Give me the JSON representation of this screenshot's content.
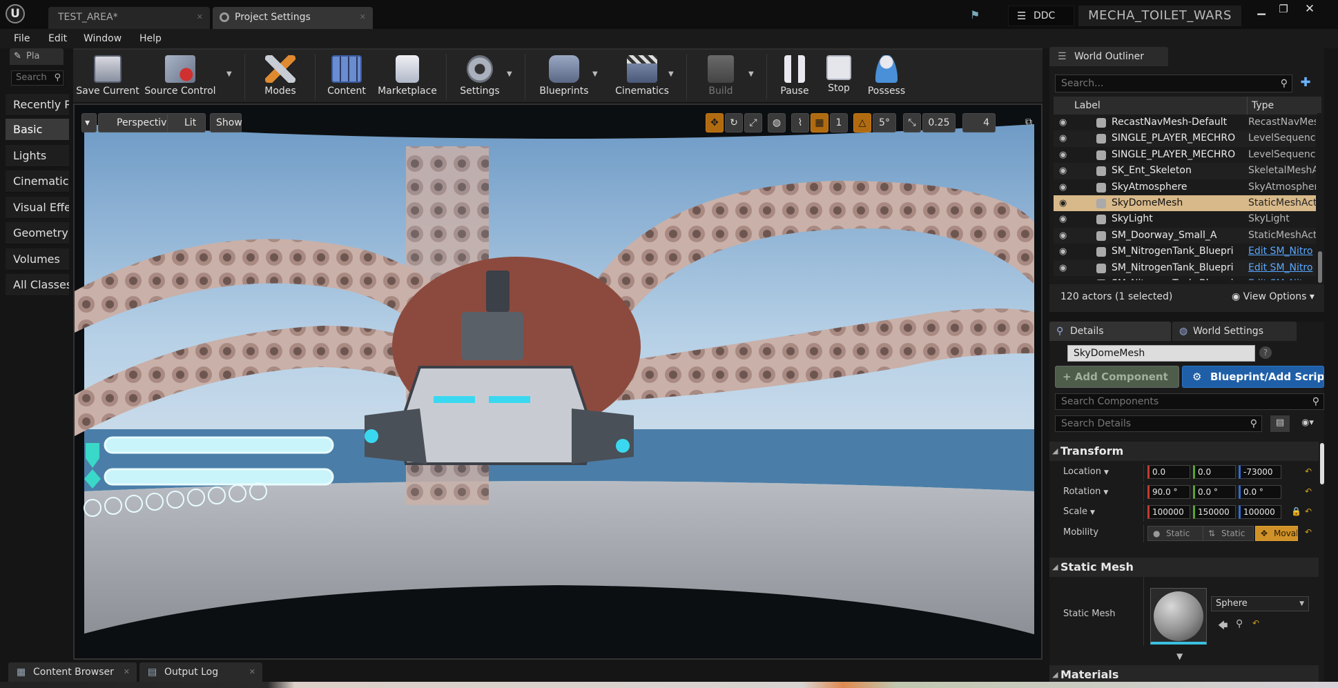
{
  "titlebar": {
    "logo": "U",
    "tabs": [
      {
        "label": "TEST_AREA*",
        "icon": "level-icon"
      },
      {
        "label": "Project Settings",
        "icon": "gear-icon"
      }
    ],
    "ddc_label": "DDC",
    "project_name": "MECHA_TOILET_WARS",
    "window_buttons": [
      "minimize",
      "maximize",
      "close"
    ]
  },
  "menu": {
    "items": [
      "File",
      "Edit",
      "Window",
      "Help"
    ]
  },
  "modes": {
    "tab_label": "Pla",
    "search_placeholder": "Search",
    "categories": [
      {
        "label": "Recently Placed"
      },
      {
        "label": "Basic",
        "active": true
      },
      {
        "label": "Lights"
      },
      {
        "label": "Cinematic"
      },
      {
        "label": "Visual Effects"
      },
      {
        "label": "Geometry"
      },
      {
        "label": "Volumes"
      },
      {
        "label": "All Classes"
      }
    ]
  },
  "toolbar": {
    "buttons": [
      {
        "label": "Save Current",
        "icon": "save-icon"
      },
      {
        "label": "Source Control",
        "icon": "source-control-icon"
      },
      {
        "label": "Modes",
        "icon": "modes-icon"
      },
      {
        "label": "Content",
        "icon": "content-icon"
      },
      {
        "label": "Marketplace",
        "icon": "marketplace-icon"
      },
      {
        "label": "Settings",
        "icon": "settings-icon"
      },
      {
        "label": "Blueprints",
        "icon": "blueprints-icon"
      },
      {
        "label": "Cinematics",
        "icon": "cinematics-icon"
      },
      {
        "label": "Build",
        "icon": "build-icon",
        "disabled": true
      },
      {
        "label": "Pause",
        "icon": "pause-icon"
      },
      {
        "label": "Stop",
        "icon": "stop-icon"
      },
      {
        "label": "Possess",
        "icon": "possess-icon"
      }
    ]
  },
  "viewport": {
    "perspective_label": "Perspective",
    "lit_label": "Lit",
    "show_label": "Show",
    "rotation_snap": "5°",
    "scale_snap": "0.25",
    "camera_speed": "4"
  },
  "outliner": {
    "tab_label": "World Outliner",
    "search_placeholder": "Search...",
    "col_label": "Label",
    "col_type": "Type",
    "rows": [
      {
        "label": "RecastNavMesh-Default",
        "type": "RecastNavMes"
      },
      {
        "label": "SINGLE_PLAYER_MECHRO",
        "type": "LevelSequence"
      },
      {
        "label": "SINGLE_PLAYER_MECHRO",
        "type": "LevelSequence"
      },
      {
        "label": "SK_Ent_Skeleton",
        "type": "SkeletalMeshA"
      },
      {
        "label": "SkyAtmosphere",
        "type": "SkyAtmospher"
      },
      {
        "label": "SkyDomeMesh",
        "type": "StaticMeshActo",
        "selected": true
      },
      {
        "label": "SkyLight",
        "type": "SkyLight"
      },
      {
        "label": "SM_Doorway_Small_A",
        "type": "StaticMeshActo"
      },
      {
        "label": "SM_NitrogenTank_Bluepri",
        "type": "Edit SM_Nitro",
        "link": true
      },
      {
        "label": "SM_NitrogenTank_Bluepri",
        "type": "Edit SM_Nitro",
        "link": true
      },
      {
        "label": "SM_NitrogenTank_Bluepri",
        "type": "Edit SM_Nitro",
        "link": true
      }
    ],
    "actor_count": "120 actors (1 selected)",
    "view_options": "View Options"
  },
  "details": {
    "tab_label": "Details",
    "world_settings_label": "World Settings",
    "actor_name": "SkyDomeMesh",
    "add_component_label": "+ Add Component",
    "blueprint_label": "Blueprint/Add Script",
    "search_components_placeholder": "Search Components",
    "search_details_placeholder": "Search Details",
    "transform": {
      "title": "Transform",
      "location_label": "Location",
      "rotation_label": "Rotation",
      "scale_label": "Scale",
      "mobility_label": "Mobility",
      "location": [
        "0.0",
        "0.0",
        "-73000"
      ],
      "rotation": [
        "90.0 °",
        "0.0 °",
        "0.0 °"
      ],
      "scale": [
        "100000",
        "150000",
        "100000"
      ],
      "mobility": [
        "Static",
        "Static",
        "Movable"
      ],
      "mobility_selected": "Movable"
    },
    "static_mesh": {
      "title": "Static Mesh",
      "label": "Static Mesh",
      "value": "Sphere"
    },
    "materials_title": "Materials"
  },
  "bottom_tabs": [
    {
      "label": "Content Browser",
      "icon": "content-browser-icon"
    },
    {
      "label": "Output Log",
      "icon": "output-log-icon"
    }
  ],
  "colors": {
    "selected_row": "#d8b98a",
    "blueprint_button": "#1f5fa8",
    "mobility_active": "#d09228",
    "hud_bar": "#c8f4fa",
    "sky": "#8fb6d8",
    "tentacle": "#c9b0a8"
  },
  "hud": {
    "health_fraction": 1.0,
    "shield_fraction": 1.0,
    "ammo_slots": 9
  }
}
